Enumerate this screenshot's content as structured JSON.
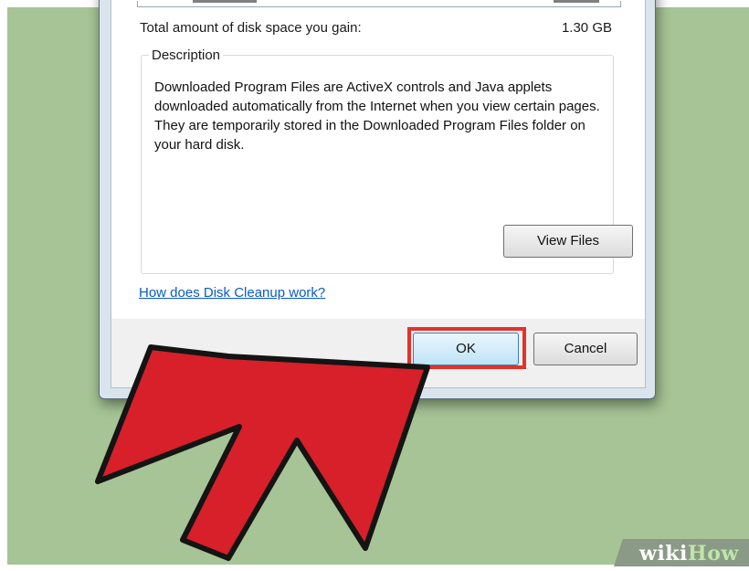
{
  "dialog": {
    "total_label": "Total amount of disk space you gain:",
    "total_value": "1.30 GB",
    "description_legend": "Description",
    "description_text": "Downloaded Program Files are ActiveX controls and Java applets downloaded automatically from the Internet when you view certain pages. They are temporarily stored in the Downloaded Program Files folder on your hard disk.",
    "view_files_label": "View Files",
    "help_link": "How does Disk Cleanup work?",
    "ok_label": "OK",
    "cancel_label": "Cancel"
  },
  "overlay": {
    "arrow_color": "#d7202a",
    "highlight_color": "#e4322b",
    "watermark_part1": "wiki",
    "watermark_part2": "How"
  },
  "colors": {
    "background": "#a6c495",
    "link": "#0a5cc2"
  }
}
